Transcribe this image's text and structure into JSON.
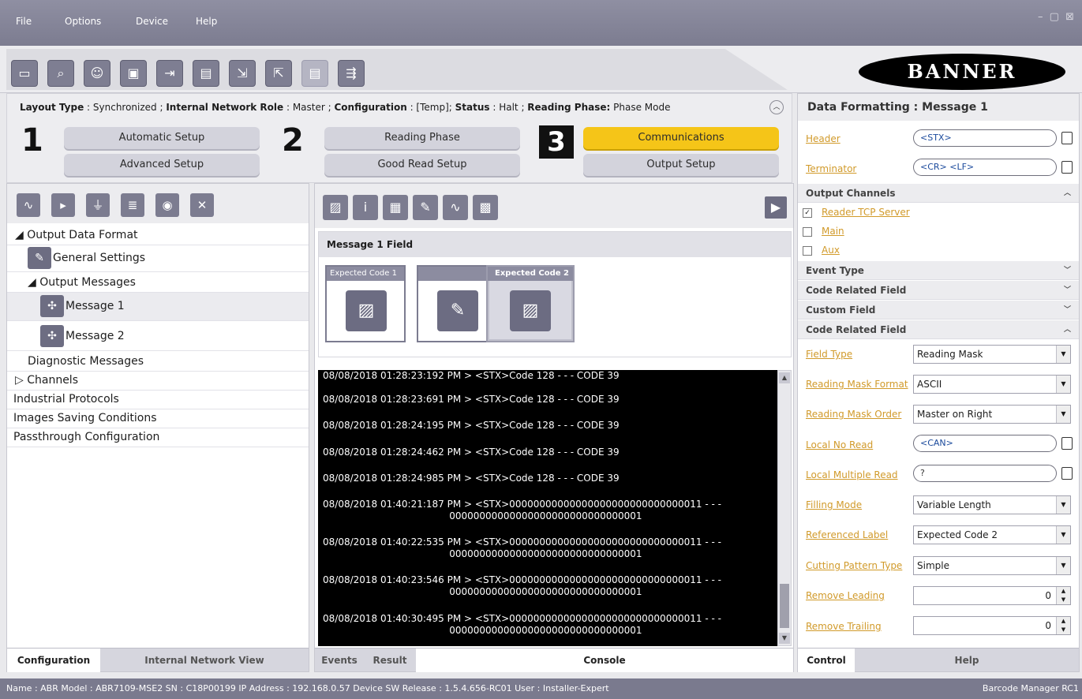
{
  "menu": {
    "file": "File",
    "options": "Options",
    "device": "Device",
    "help": "Help"
  },
  "window_controls": "– ▢ ⊠",
  "toolbar": {
    "icons": [
      "reader-icon",
      "find-icon",
      "user-settings-icon",
      "window-icon",
      "send-icon",
      "save-icon",
      "export-icon",
      "import-icon",
      "disabled-icon",
      "network-icon"
    ],
    "logo": "BANNER"
  },
  "status": {
    "layout_type_label": "Layout Type",
    "layout_type": "Synchronized",
    "network_role_label": "Internal Network Role",
    "network_role": "Master",
    "configuration_label": "Configuration",
    "configuration": "[Temp]",
    "status_label": "Status",
    "status": "Halt",
    "reading_phase_label": "Reading Phase:",
    "reading_phase": "Phase Mode"
  },
  "steps": {
    "one": "1",
    "two": "2",
    "three": "3",
    "automatic_setup": "Automatic Setup",
    "advanced_setup": "Advanced Setup",
    "reading_phase": "Reading Phase",
    "good_read_setup": "Good Read Setup",
    "communications": "Communications",
    "output_setup": "Output Setup"
  },
  "tree": {
    "output_data_format": "◢ Output Data Format",
    "general_settings": "General Settings",
    "output_messages": "◢ Output Messages",
    "message1": "Message 1",
    "message2": "Message 2",
    "diagnostic_messages": "Diagnostic Messages",
    "channels": "▷ Channels",
    "industrial_protocols": "Industrial Protocols",
    "images_saving": "Images Saving Conditions",
    "passthrough": "Passthrough Configuration"
  },
  "left_tabs": {
    "configuration": "Configuration",
    "network_view": "Internal Network View"
  },
  "message_field": {
    "title": "Message 1 Field",
    "card1": "Expected Code  1",
    "card2": "",
    "card3": "Expected Code  2"
  },
  "console_lines": [
    "08/08/2018 01:28:23:192 PM > <STX>Code 128 - - - CODE 39",
    "08/08/2018 01:28:23:691 PM > <STX>Code 128 - - - CODE 39",
    "08/08/2018 01:28:24:195 PM > <STX>Code 128 - - - CODE 39",
    "08/08/2018 01:28:24:462 PM > <STX>Code 128 - - - CODE 39",
    "08/08/2018 01:28:24:985 PM > <STX>Code 128 - - - CODE 39",
    "08/08/2018 01:40:21:187 PM > <STX>00000000000000000000000000000011 - - -\n                                          00000000000000000000000000000001",
    "08/08/2018 01:40:22:535 PM > <STX>00000000000000000000000000000011 - - -\n                                          00000000000000000000000000000001",
    "08/08/2018 01:40:23:546 PM > <STX>00000000000000000000000000000011 - - -\n                                          00000000000000000000000000000001",
    "08/08/2018 01:40:30:495 PM > <STX>00000000000000000000000000000011 - - -\n                                          00000000000000000000000000000001"
  ],
  "mid_tabs": {
    "events": "Events",
    "result": "Result",
    "console": "Console"
  },
  "right": {
    "title": "Data Formatting :  Message 1",
    "header_label": "Header",
    "header_value": "<STX>",
    "terminator_label": "Terminator",
    "terminator_value": "<CR> <LF>",
    "output_channels": "Output Channels",
    "ch_reader": "Reader TCP Server",
    "ch_main": "Main",
    "ch_aux": "Aux",
    "event_type": "Event Type",
    "code_related_field": "Code Related Field",
    "custom_field": "Custom Field",
    "code_related_field2": "Code Related Field",
    "field_type_label": "Field Type",
    "field_type": "Reading Mask",
    "mask_format_label": "Reading Mask Format",
    "mask_format": "ASCII",
    "mask_order_label": "Reading Mask Order",
    "mask_order": "Master on Right",
    "local_noread_label": "Local No Read",
    "local_noread": "<CAN>",
    "local_multiple_label": "Local Multiple Read",
    "local_multiple": "?",
    "filling_mode_label": "Filling Mode",
    "filling_mode": "Variable Length",
    "ref_label_label": "Referenced Label",
    "ref_label": "Expected Code  2",
    "cutting_label": "Cutting Pattern Type",
    "cutting": "Simple",
    "remove_leading_label": "Remove Leading",
    "remove_leading": "0",
    "remove_trailing_label": "Remove Trailing",
    "remove_trailing": "0"
  },
  "right_tabs": {
    "control": "Control",
    "help": "Help"
  },
  "footer": {
    "info": "Name : ABR   Model : ABR7109-MSE2   SN : C18P00199   IP Address :  192.168.0.57   Device SW Release : 1.5.4.656-RC01   User : Installer-Expert",
    "app": "Barcode Manager RC1"
  },
  "colors": {
    "accent": "#f5c518",
    "link": "#d19a2a",
    "chrome": "#7c7c90"
  }
}
